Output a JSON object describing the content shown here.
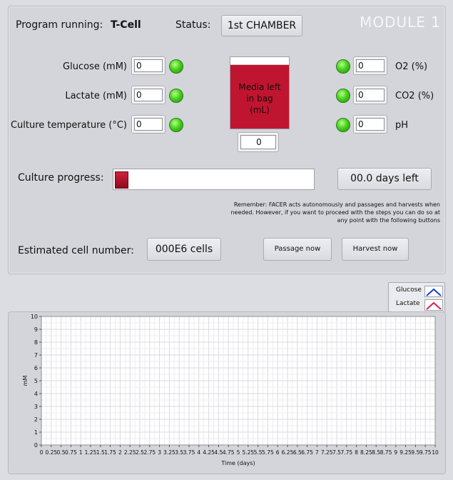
{
  "header": {
    "program_label": "Program running:",
    "program_name": "T-Cell",
    "status_label": "Status:",
    "status_value": "1st CHAMBER",
    "module_title": "MODULE 1"
  },
  "sensors_left": [
    {
      "label": "Glucose (mM)",
      "value": "0"
    },
    {
      "label": "Lactate (mM)",
      "value": "0"
    },
    {
      "label": "Culture temperature (°C)",
      "value": "0"
    }
  ],
  "sensors_right": [
    {
      "label": "O2 (%)",
      "value": "0"
    },
    {
      "label": "CO2 (%)",
      "value": "0"
    },
    {
      "label": "pH",
      "value": "0"
    }
  ],
  "media": {
    "label": "Media left in bag (mL)",
    "label_lines": [
      "Media left",
      "in bag",
      "(mL)"
    ],
    "value": "0"
  },
  "progress": {
    "label": "Culture progress:",
    "fraction": 0.06,
    "days_left": "00.0 days left"
  },
  "note": "Remember: FACER acts autonomously and passages and harvests when needed. However, if you want to proceed with the steps you can do so at any point with the following buttons",
  "cells": {
    "label": "Estimated cell number:",
    "value": "000E6 cells"
  },
  "buttons": {
    "passage": "Passage now",
    "harvest": "Harvest now"
  },
  "legend": [
    {
      "name": "Glucose",
      "color": "#1a3fd6"
    },
    {
      "name": "Lactate",
      "color": "#e0204a"
    }
  ],
  "chart_data": {
    "type": "line",
    "xlabel": "Time (days)",
    "ylabel": "mM",
    "xlim": [
      0,
      10
    ],
    "ylim": [
      0,
      10
    ],
    "x_ticks": [
      "0",
      "0.25",
      "0.5",
      "0.75",
      "1",
      "1.25",
      "1.5",
      "1.75",
      "2",
      "2.25",
      "2.5",
      "2.75",
      "3",
      "3.25",
      "3.5",
      "3.75",
      "4",
      "4.25",
      "4.5",
      "4.75",
      "5",
      "5.25",
      "5.5",
      "5.75",
      "6",
      "6.25",
      "6.5",
      "6.75",
      "7",
      "7.25",
      "7.5",
      "7.75",
      "8",
      "8.25",
      "8.5",
      "8.75",
      "9",
      "9.25",
      "9.5",
      "9.75",
      "10"
    ],
    "y_ticks": [
      "0",
      "1",
      "2",
      "3",
      "4",
      "5",
      "6",
      "7",
      "8",
      "9",
      "10"
    ],
    "grid": true,
    "series": [
      {
        "name": "Glucose",
        "values": []
      },
      {
        "name": "Lactate",
        "values": []
      }
    ]
  }
}
